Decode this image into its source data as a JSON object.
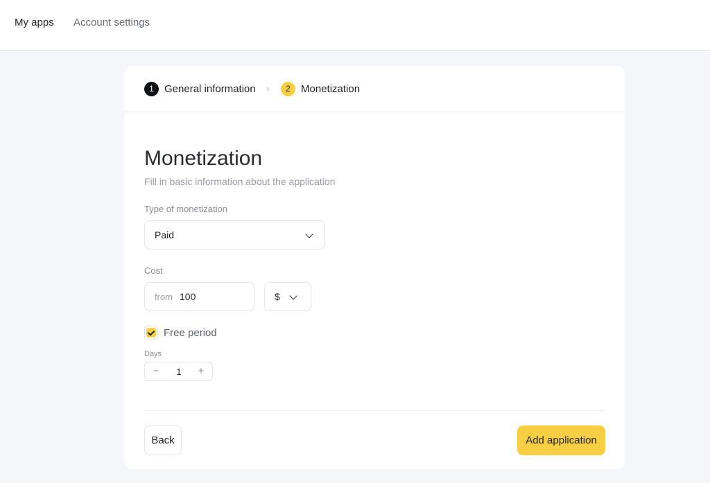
{
  "nav": {
    "items": [
      {
        "label": "My apps"
      },
      {
        "label": "Account settings"
      }
    ]
  },
  "stepper": {
    "steps": [
      {
        "number": "1",
        "label": "General information"
      },
      {
        "number": "2",
        "label": "Monetization"
      }
    ],
    "separator": "›"
  },
  "form": {
    "title": "Monetization",
    "subtitle": "Fill in basic information about the application",
    "monetization_type": {
      "label": "Type of monetization",
      "value": "Paid"
    },
    "cost": {
      "label": "Cost",
      "prefix": "from",
      "value": "100",
      "currency": "$"
    },
    "free_period": {
      "label": "Free period",
      "checked": true
    },
    "days": {
      "label": "Days",
      "value": "1",
      "minus": "−",
      "plus": "+"
    }
  },
  "actions": {
    "back_label": "Back",
    "add_label": "Add application"
  },
  "colors": {
    "accent": "#f7cf45",
    "background": "#f5f6fa"
  }
}
